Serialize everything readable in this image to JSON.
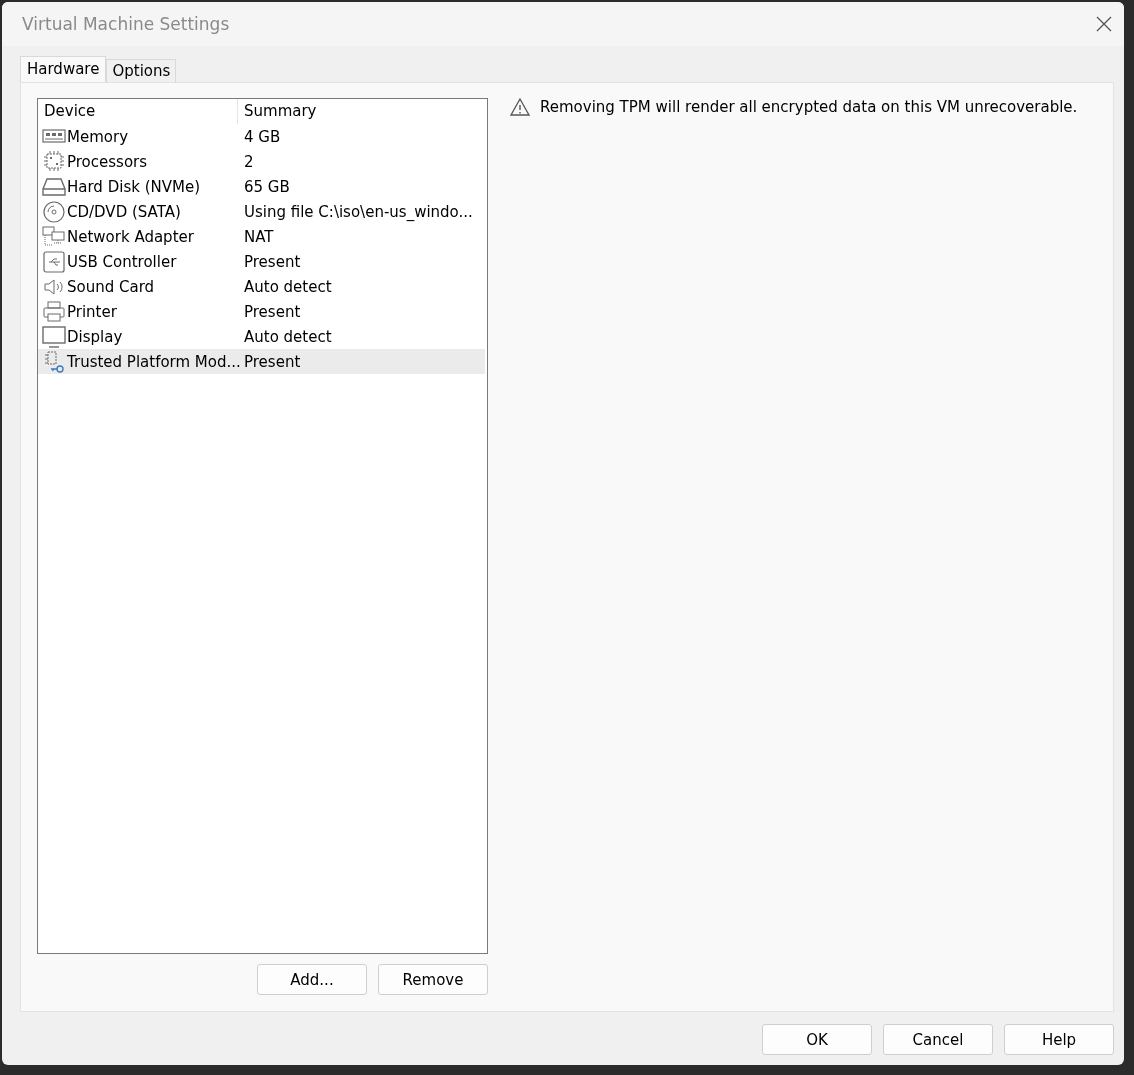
{
  "window": {
    "title": "Virtual Machine Settings"
  },
  "tabs": [
    {
      "label": "Hardware",
      "selected": true
    },
    {
      "label": "Options",
      "selected": false
    }
  ],
  "device_list": {
    "columns": [
      "Device",
      "Summary"
    ],
    "rows": [
      {
        "kind": "memory",
        "device": "Memory",
        "summary": "4 GB",
        "selected": false
      },
      {
        "kind": "processor",
        "device": "Processors",
        "summary": "2",
        "selected": false
      },
      {
        "kind": "disk",
        "device": "Hard Disk (NVMe)",
        "summary": "65 GB",
        "selected": false
      },
      {
        "kind": "cd",
        "device": "CD/DVD (SATA)",
        "summary": "Using file C:\\iso\\en-us_windo...",
        "selected": false
      },
      {
        "kind": "network",
        "device": "Network Adapter",
        "summary": "NAT",
        "selected": false
      },
      {
        "kind": "usb",
        "device": "USB Controller",
        "summary": "Present",
        "selected": false
      },
      {
        "kind": "sound",
        "device": "Sound Card",
        "summary": "Auto detect",
        "selected": false
      },
      {
        "kind": "printer",
        "device": "Printer",
        "summary": "Present",
        "selected": false
      },
      {
        "kind": "display",
        "device": "Display",
        "summary": "Auto detect",
        "selected": false
      },
      {
        "kind": "tpm",
        "device": "Trusted Platform Mod...",
        "summary": "Present",
        "selected": true
      }
    ]
  },
  "list_buttons": [
    "Add...",
    "Remove"
  ],
  "warning": "Removing TPM will render all encrypted data on this VM unrecoverable.",
  "dialog_buttons": [
    "OK",
    "Cancel",
    "Help"
  ]
}
